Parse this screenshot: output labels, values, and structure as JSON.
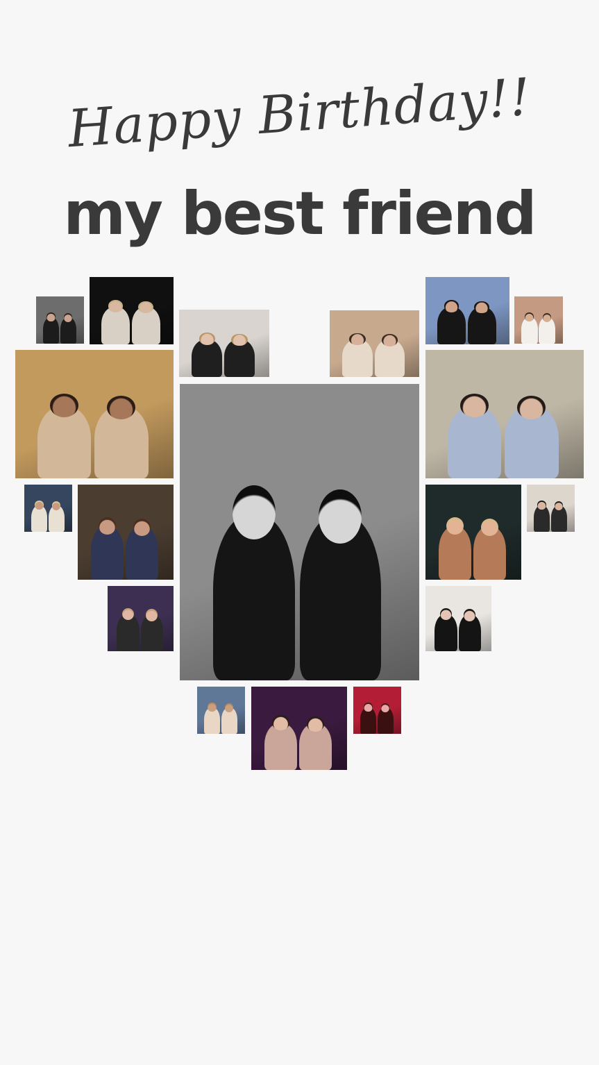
{
  "header": {
    "script_title": "Happy Birthday!!",
    "main_title": "my best friend"
  },
  "photos": [
    {
      "name": "photo-top-left-small",
      "bg": "#6d6d6d",
      "body": "#1c1c1c",
      "skin": "#c9a48e",
      "hair": "#2a2522"
    },
    {
      "name": "photo-night-blondes",
      "bg": "#101010",
      "body": "#d8d0c5",
      "skin": "#d9b8a0",
      "hair": "#c8b08a"
    },
    {
      "name": "photo-two-girls-indoor",
      "bg": "#d9d4cf",
      "body": "#1f1f1f",
      "skin": "#e2c2ac",
      "hair": "#b99667"
    },
    {
      "name": "photo-cake",
      "bg": "#c7a98e",
      "body": "#e7d9c9",
      "skin": "#d7b09a",
      "hair": "#3b2c22"
    },
    {
      "name": "photo-sunset-city",
      "bg": "#7d96c2",
      "body": "#161616",
      "skin": "#d0a488",
      "hair": "#1a1614"
    },
    {
      "name": "photo-sunset-hills",
      "bg": "#c49a82",
      "body": "#f3f0ec",
      "skin": "#d6ae92",
      "hair": "#3a2b22"
    },
    {
      "name": "photo-hug-mall",
      "bg": "#c39a5e",
      "body": "#d3b799",
      "skin": "#a77759",
      "hair": "#2b1c16"
    },
    {
      "name": "photo-cafe-terrace",
      "bg": "#bfb7a6",
      "body": "#a9b6cf",
      "skin": "#d9b69f",
      "hair": "#241a16"
    },
    {
      "name": "photo-sunglasses",
      "bg": "#35465e",
      "body": "#e8e0d2",
      "skin": "#c99a80",
      "hair": "#d9c79e"
    },
    {
      "name": "photo-night-street-hug",
      "bg": "#4b3d30",
      "body": "#2f3656",
      "skin": "#c89a82",
      "hair": "#4a2e1e"
    },
    {
      "name": "photo-golden-hour",
      "bg": "#1f2a2a",
      "body": "#b57a58",
      "skin": "#e2b394",
      "hair": "#d8b98a"
    },
    {
      "name": "photo-white-wall",
      "bg": "#ddd6cd",
      "body": "#2a2a2a",
      "skin": "#d9b69f",
      "hair": "#1f1a18"
    },
    {
      "name": "photo-concert-lights",
      "bg": "#3d2f52",
      "body": "#2a2a2a",
      "skin": "#e1b7a4",
      "hair": "#c6a27a"
    },
    {
      "name": "photo-smiling-duo",
      "bg": "#e9e6e2",
      "body": "#141414",
      "skin": "#e4c4b4",
      "hair": "#1f1816"
    },
    {
      "name": "photo-rooftop-pool",
      "bg": "#607898",
      "body": "#ead6c4",
      "skin": "#caa080",
      "hair": "#b98a5c"
    },
    {
      "name": "photo-club-stage",
      "bg": "#3a1a3e",
      "body": "#c9a59a",
      "skin": "#e3bca6",
      "hair": "#2a1c18"
    },
    {
      "name": "photo-red-party",
      "bg": "#b31d35",
      "body": "#3b1010",
      "skin": "#e8a9a9",
      "hair": "#451818"
    },
    {
      "name": "photo-center-selfie",
      "bg": "#8c8c8c",
      "body": "#151515",
      "skin": "#d6d6d6",
      "hair": "#0e0e0e"
    }
  ]
}
